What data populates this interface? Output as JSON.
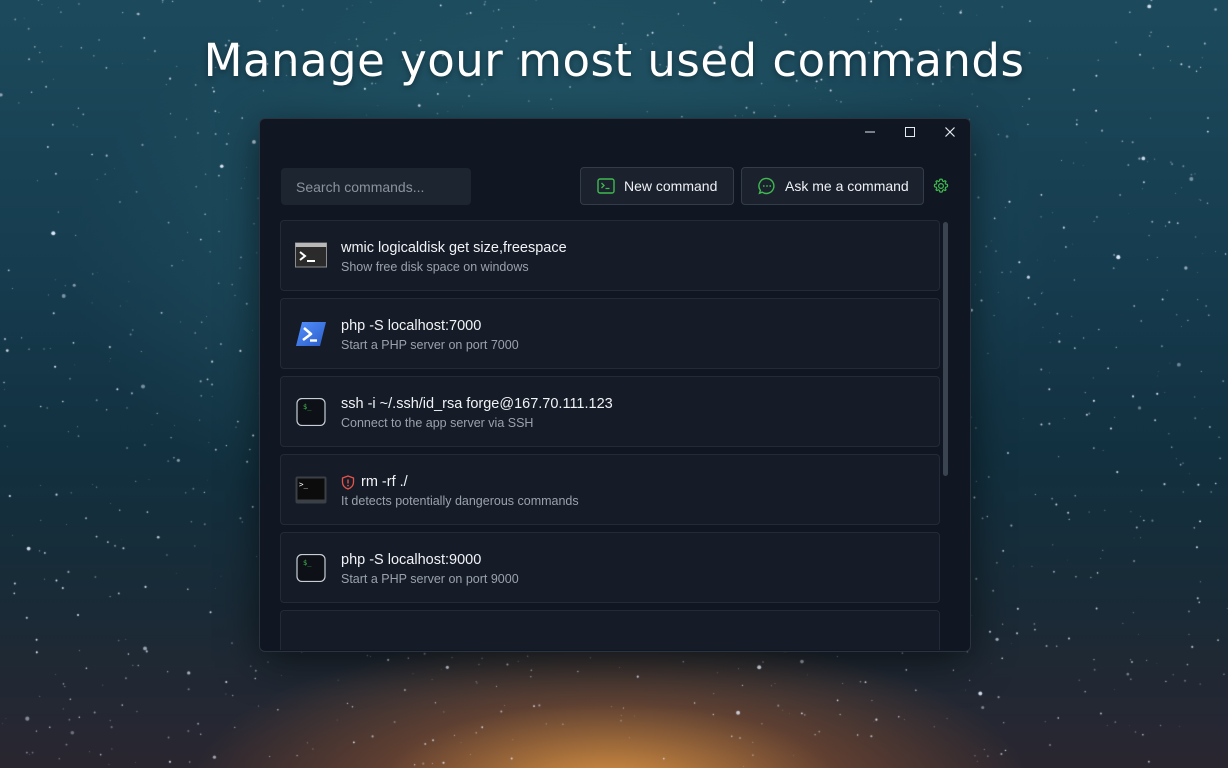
{
  "headline": "Manage your most used commands",
  "window": {
    "controls": {
      "minimize": "—",
      "maximize": "☐",
      "close": "✕"
    }
  },
  "search": {
    "placeholder": "Search commands..."
  },
  "toolbar": {
    "new_label": "New command",
    "ask_label": "Ask me a command",
    "settings_icon": "gear-icon"
  },
  "colors": {
    "accent_green": "#3fb950",
    "danger_red": "#e5534b",
    "window_bg": "#101722",
    "item_bg": "#151c27"
  },
  "commands": [
    {
      "icon": "cmd-terminal-icon",
      "command": "wmic logicaldisk get size,freespace",
      "description": "Show free disk space on windows",
      "dangerous": false
    },
    {
      "icon": "powershell-icon",
      "command": "php -S localhost:7000",
      "description": "Start a PHP server on port 7000",
      "dangerous": false
    },
    {
      "icon": "bash-terminal-icon",
      "command": "ssh -i ~/.ssh/id_rsa forge@167.70.111.123",
      "description": "Connect to the app server via SSH",
      "dangerous": false
    },
    {
      "icon": "windows-terminal-icon",
      "command": "rm -rf ./",
      "description": "It detects potentially dangerous commands",
      "dangerous": true
    },
    {
      "icon": "bash-terminal-icon",
      "command": "php -S localhost:9000",
      "description": "Start a PHP server on port 9000",
      "dangerous": false
    }
  ]
}
